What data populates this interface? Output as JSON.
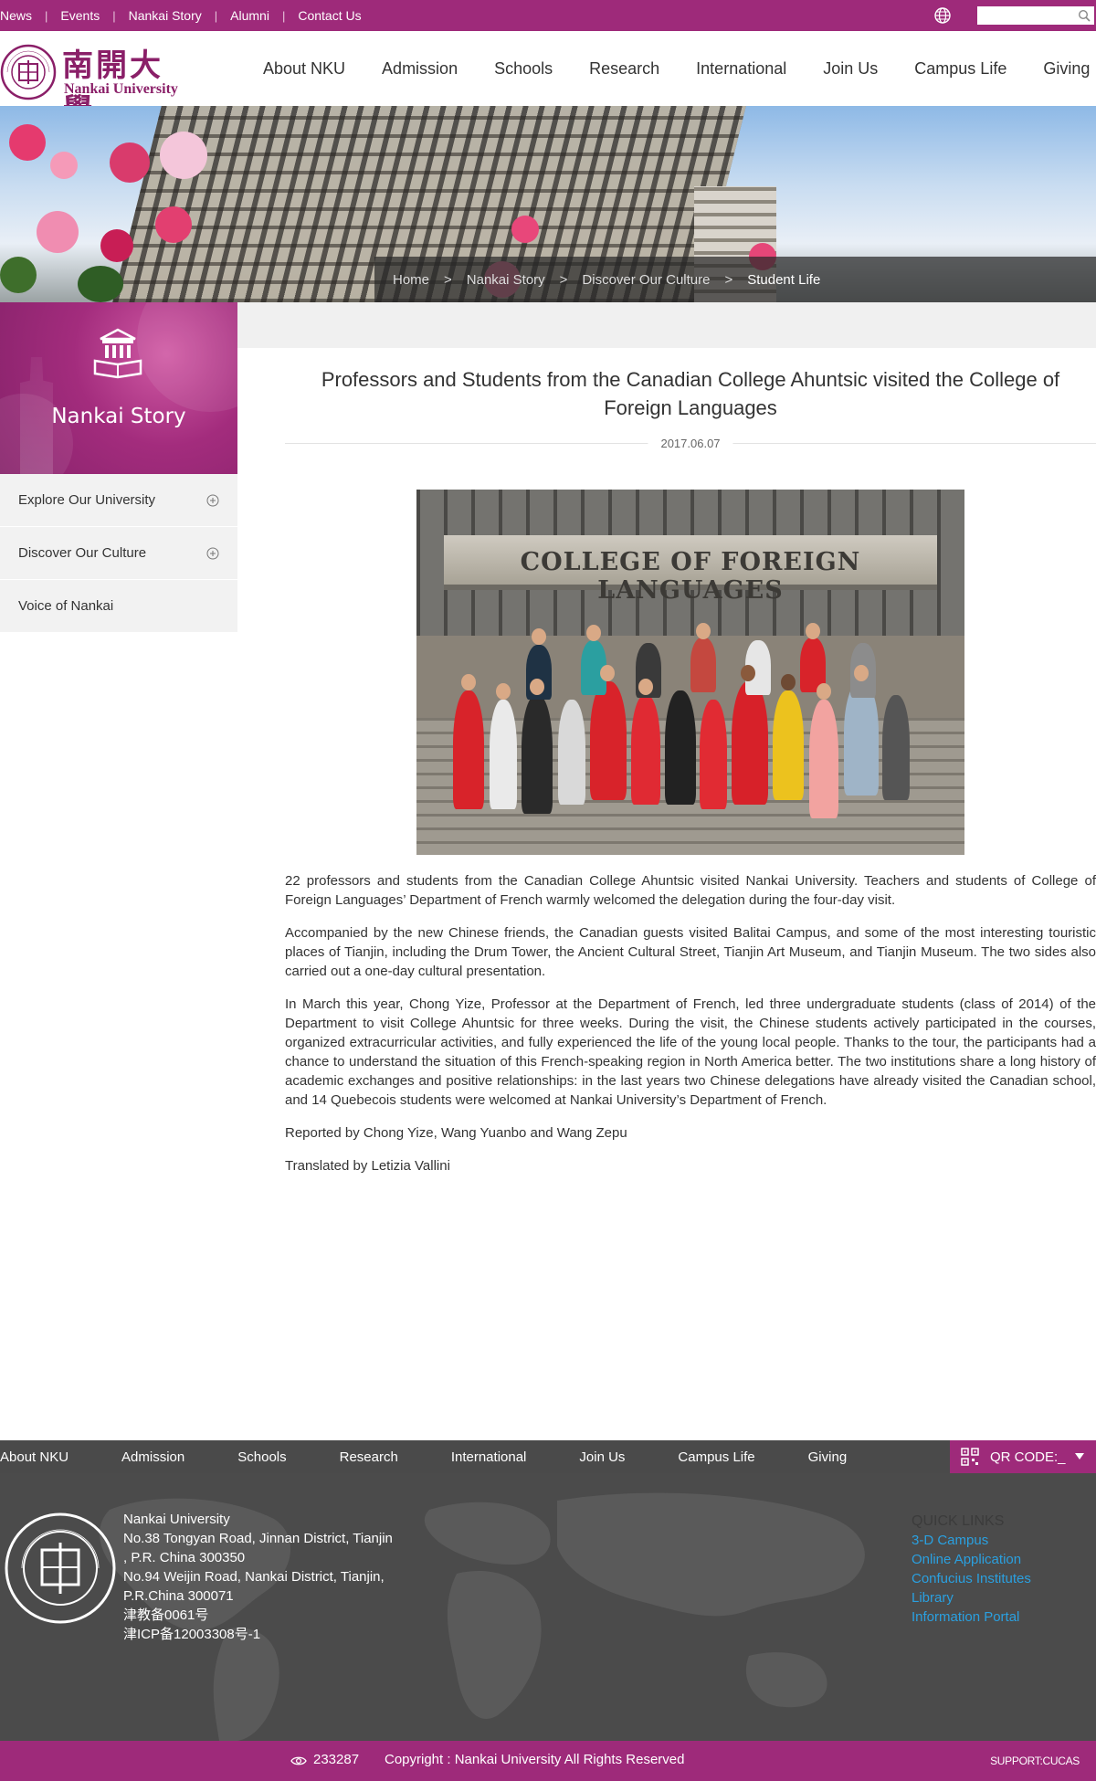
{
  "topbar": {
    "links": [
      "News",
      "Events",
      "Nankai Story",
      "Alumni",
      "Contact Us"
    ],
    "separator": "|",
    "search_placeholder": ""
  },
  "header": {
    "logo_cn": "南開大學",
    "logo_en": "Nankai University",
    "seal_text": "NANKAI UNIVERSITY",
    "seal_year": "1919",
    "nav": [
      "About NKU",
      "Admission",
      "Schools",
      "Research",
      "International",
      "Join Us",
      "Campus Life",
      "Giving"
    ]
  },
  "breadcrumb": {
    "items": [
      "Home",
      "Nankai Story",
      "Discover Our Culture",
      "Student Life"
    ],
    "separator": ">"
  },
  "sidebar": {
    "title": "Nankai Story",
    "items": [
      {
        "label": "Explore Our University",
        "expandable": true
      },
      {
        "label": "Discover Our Culture",
        "expandable": true
      },
      {
        "label": "Voice of Nankai",
        "expandable": false
      }
    ]
  },
  "article": {
    "title": "Professors and Students from the Canadian College Ahuntsic visited the College of Foreign Languages",
    "date": "2017.06.07",
    "photo_sign": "COLLEGE OF FOREIGN LANGUAGES",
    "paragraphs": [
      "22 professors and students from the Canadian College Ahuntsic visited Nankai University. Teachers and students of College of Foreign Languages’ Department of French warmly welcomed the delegation during the four-day visit.",
      "Accompanied by the new Chinese friends, the Canadian guests visited Balitai Campus, and some of the most interesting touristic places of Tianjin, including the Drum Tower, the Ancient Cultural Street, Tianjin Art Museum, and Tianjin Museum. The two sides also carried out a one-day cultural presentation.",
      "In March this year, Chong Yize, Professor at the Department of French, led three undergraduate students (class of 2014) of the Department to visit College Ahuntsic for three weeks. During the visit, the Chinese students actively participated in the courses, organized extracurricular activities, and fully experienced the life of the young local people. Thanks to the tour, the participants had a chance to understand the situation of this French-speaking region in North America better. The two institutions share a long history of academic exchanges and positive relationships: in the last years two Chinese delegations have already visited the Canadian school, and 14 Quebecois students were welcomed at Nankai University’s Department of French.",
      "Reported by Chong Yize, Wang Yuanbo and Wang Zepu",
      "Translated by Letizia Vallini"
    ]
  },
  "footer": {
    "nav": [
      "About NKU",
      "Admission",
      "Schools",
      "Research",
      "International",
      "Join Us",
      "Campus Life",
      "Giving"
    ],
    "qr_label": "QR CODE:_",
    "address_lines": [
      "Nankai University",
      "No.38 Tongyan Road, Jinnan District, Tianjin",
      ", P.R. China 300350",
      "No.94 Weijin Road,  Nankai District, Tianjin,",
      "P.R.China  300071",
      "津教备0061号",
      "津ICP备12003308号-1"
    ],
    "quick_links_title": "QUICK LINKS",
    "quick_links": [
      "3-D Campus",
      "Online Application",
      "Confucius Institutes",
      "Library",
      "Information Portal"
    ],
    "visit_count": "233287",
    "copyright": "Copyright : Nankai University All Rights Reserved",
    "support": "SUPPORT:CUCAS"
  },
  "colors": {
    "brand_purple": "#9e2a7a",
    "link_blue": "#2aa0e0",
    "footer_gray": "#4b4b4b"
  },
  "icons": [
    "globe-icon",
    "search-icon",
    "building-icon",
    "plus-circle-icon",
    "qr-code-icon",
    "caret-down-icon",
    "eye-icon"
  ]
}
